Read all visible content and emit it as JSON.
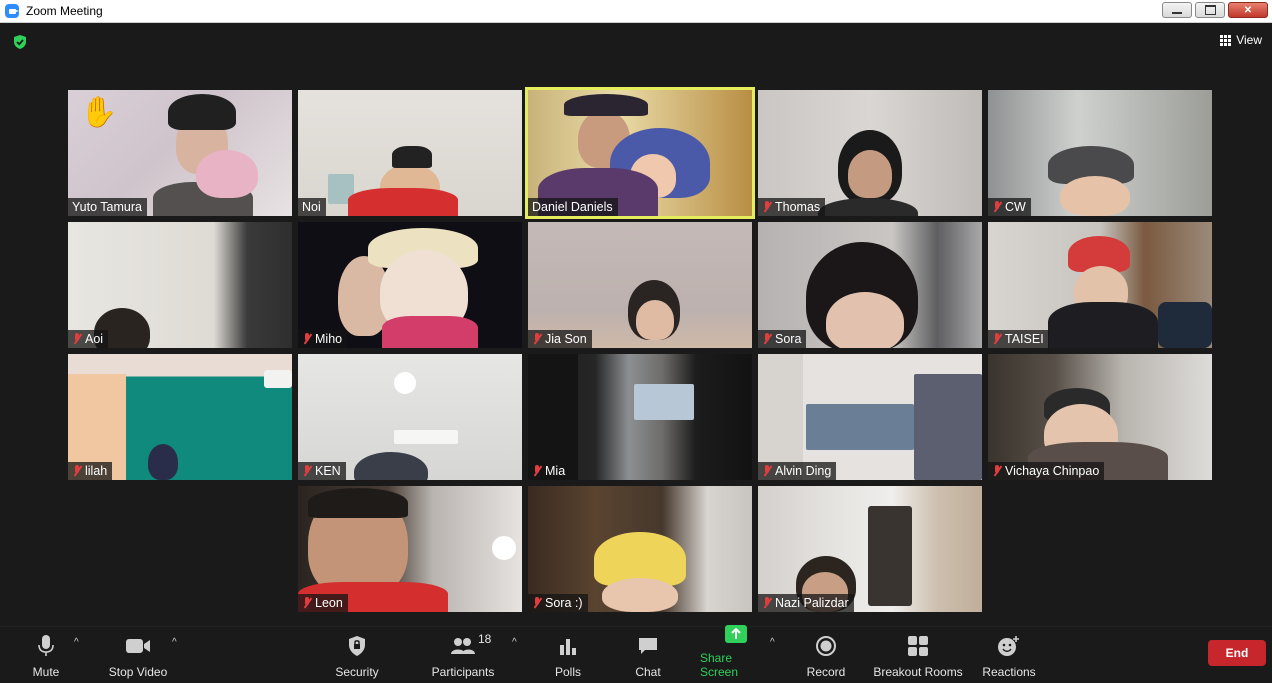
{
  "window": {
    "title": "Zoom Meeting"
  },
  "topbar": {
    "view_label": "View"
  },
  "participants_grid": [
    {
      "name": "Yuto Tamura",
      "muted": false,
      "raised_hand": true,
      "active": false
    },
    {
      "name": "Noi",
      "muted": false,
      "raised_hand": false,
      "active": false
    },
    {
      "name": "Daniel Daniels",
      "muted": false,
      "raised_hand": false,
      "active": true
    },
    {
      "name": "Thomas",
      "muted": true,
      "raised_hand": false,
      "active": false
    },
    {
      "name": "CW",
      "muted": true,
      "raised_hand": false,
      "active": false
    },
    {
      "name": "Aoi",
      "muted": true,
      "raised_hand": false,
      "active": false
    },
    {
      "name": "Miho",
      "muted": true,
      "raised_hand": false,
      "active": false
    },
    {
      "name": "Jia Son",
      "muted": true,
      "raised_hand": false,
      "active": false
    },
    {
      "name": "Sora",
      "muted": true,
      "raised_hand": false,
      "active": false
    },
    {
      "name": "TAISEI",
      "muted": true,
      "raised_hand": false,
      "active": false
    },
    {
      "name": "lilah",
      "muted": true,
      "raised_hand": false,
      "active": false
    },
    {
      "name": "KEN",
      "muted": true,
      "raised_hand": false,
      "active": false
    },
    {
      "name": "Mia",
      "muted": true,
      "raised_hand": false,
      "active": false
    },
    {
      "name": "Alvin Ding",
      "muted": true,
      "raised_hand": false,
      "active": false
    },
    {
      "name": "Vichaya Chinpao",
      "muted": true,
      "raised_hand": false,
      "active": false
    },
    {
      "name": "Leon",
      "muted": true,
      "raised_hand": false,
      "active": false
    },
    {
      "name": "Sora :)",
      "muted": true,
      "raised_hand": false,
      "active": false
    },
    {
      "name": "Nazi Palizdar",
      "muted": true,
      "raised_hand": false,
      "active": false
    }
  ],
  "toolbar": {
    "mute_label": "Mute",
    "stop_video_label": "Stop Video",
    "security_label": "Security",
    "participants_label": "Participants",
    "participants_count": "18",
    "polls_label": "Polls",
    "chat_label": "Chat",
    "share_screen_label": "Share Screen",
    "record_label": "Record",
    "breakout_rooms_label": "Breakout Rooms",
    "reactions_label": "Reactions",
    "end_label": "End"
  },
  "colors": {
    "background": "#1a1a1a",
    "active_speaker_border": "#e4ee5c",
    "share_green": "#2fd15b",
    "end_red": "#c7262d",
    "muted_red": "#e03e3e"
  },
  "icons": {
    "shield": "shield-check-icon",
    "raised_hand": "raised-hand-icon",
    "muted_mic": "muted-mic-icon"
  }
}
